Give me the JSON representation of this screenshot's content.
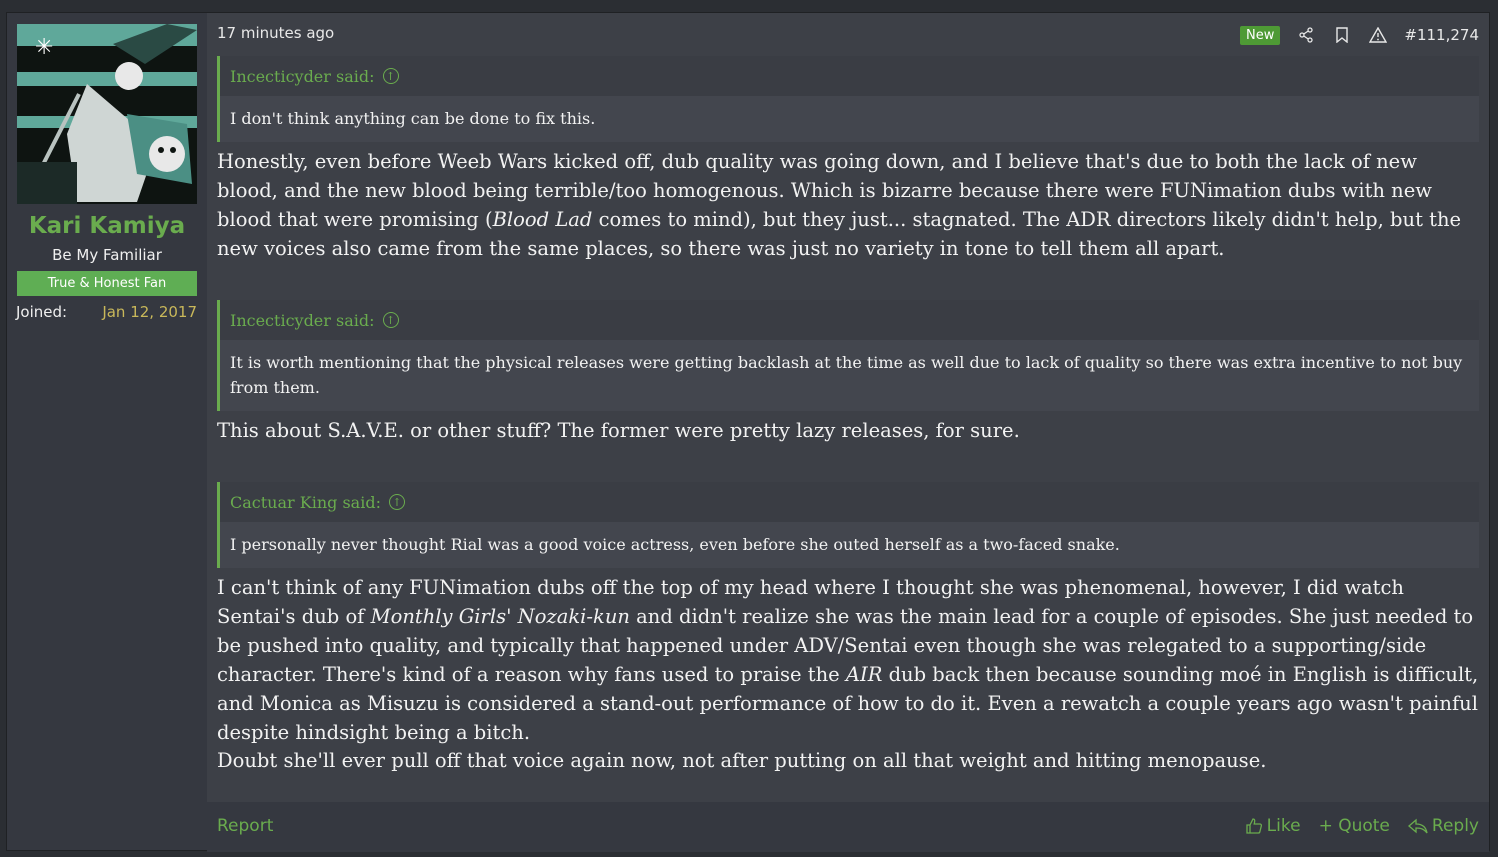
{
  "user": {
    "name": "Kari Kamiya",
    "title": "Be My Familiar",
    "banner": "True & Honest Fan",
    "joined_label": "Joined:",
    "joined_value": "Jan 12, 2017"
  },
  "post": {
    "time": "17 minutes ago",
    "new_badge": "New",
    "number": "#111,274"
  },
  "content": {
    "quote1": {
      "author": "Incecticyder said:",
      "text": "I don't think anything can be done to fix this."
    },
    "para1_a": "Honestly, even before Weeb Wars kicked off, dub quality was going down, and I believe that's due to both the lack of new blood, and the new blood being terrible/too homogenous. Which is bizarre because there were FUNimation dubs with new blood that were promising (",
    "para1_em": "Blood Lad",
    "para1_b": " comes to mind), but they just... stagnated. The ADR directors likely didn't help, but the new voices also came from the same places, so there was just no variety in tone to tell them all apart.",
    "quote2": {
      "author": "Incecticyder said:",
      "text": "It is worth mentioning that the physical releases were getting backlash at the time as well due to lack of quality so there was extra incentive to not buy from them."
    },
    "para2": "This about S.A.V.E. or other stuff? The former were pretty lazy releases, for sure.",
    "quote3": {
      "author": "Cactuar King said:",
      "text": "I personally never thought Rial was a good voice actress, even before she outed herself as a two-faced snake."
    },
    "para3_a": "I can't think of any FUNimation dubs off the top of my head where I thought she was phenomenal, however, I did watch Sentai's dub of ",
    "para3_em1": "Monthly Girls' Nozaki-kun",
    "para3_b": " and didn't realize she was the main lead for a couple of episodes. She just needed to be pushed into quality, and typically that happened under ADV/Sentai even though she was relegated to a supporting/side character. There's kind of a reason why fans used to praise the ",
    "para3_em2": "AIR",
    "para3_c": " dub back then because sounding moé in English is difficult, and Monica as Misuzu is considered a stand-out performance of how to do it. Even a rewatch a couple years ago wasn't painful despite hindsight being a bitch.",
    "para4": "Doubt she'll ever pull off that voice again now, not after putting on all that weight and hitting menopause."
  },
  "footer": {
    "report": "Report",
    "like": "Like",
    "quote": "+ Quote",
    "reply": "Reply"
  }
}
